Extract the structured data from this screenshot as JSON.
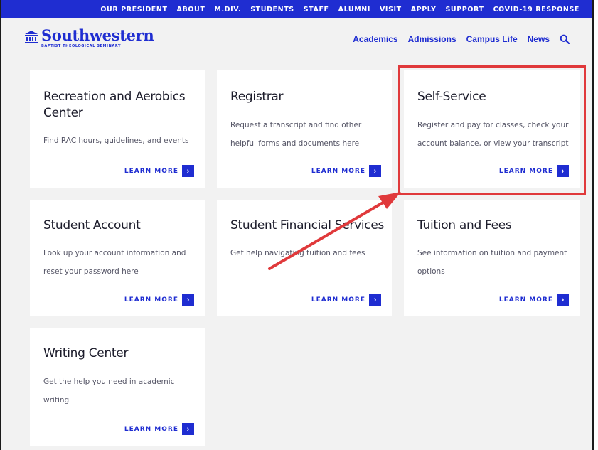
{
  "topnav": {
    "items": [
      "OUR PRESIDENT",
      "ABOUT",
      "M.DIV.",
      "STUDENTS",
      "STAFF",
      "ALUMNI",
      "VISIT",
      "APPLY",
      "SUPPORT",
      "COVID-19 RESPONSE"
    ]
  },
  "logo": {
    "title": "Southwestern",
    "subtitle": "BAPTIST THEOLOGICAL SEMINARY"
  },
  "mainnav": {
    "items": [
      "Academics",
      "Admissions",
      "Campus Life",
      "News"
    ],
    "search_icon": "search-icon"
  },
  "cards": [
    {
      "title": "Recreation and Aerobics Center",
      "desc": "Find RAC hours, guidelines, and events",
      "link": "LEARN MORE"
    },
    {
      "title": "Registrar",
      "desc": "Request a transcript and find other helpful forms and documents here",
      "link": "LEARN MORE"
    },
    {
      "title": "Self-Service",
      "desc": "Register and pay for classes, check your account balance, or view your transcript",
      "link": "LEARN MORE"
    },
    {
      "title": "Student Account",
      "desc": "Look up your account information and reset your password here",
      "link": "LEARN MORE"
    },
    {
      "title": "Student Financial Services",
      "desc": "Get help navigating tuition and fees",
      "link": "LEARN MORE"
    },
    {
      "title": "Tuition and Fees",
      "desc": "See information on tuition and payment options",
      "link": "LEARN MORE"
    },
    {
      "title": "Writing Center",
      "desc": "Get the help you need in academic writing",
      "link": "LEARN MORE"
    }
  ],
  "colors": {
    "brand_blue": "#1f2dd1",
    "annotation_red": "#e0393b"
  }
}
